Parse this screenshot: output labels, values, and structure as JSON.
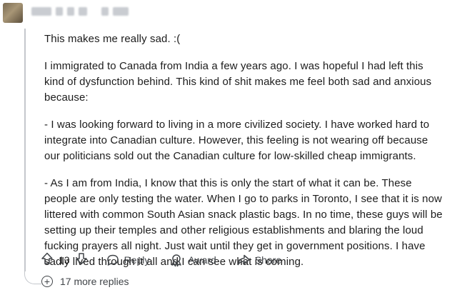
{
  "comment": {
    "paragraphs": [
      "This makes me really sad. :(",
      "I immigrated to Canada from India a few years ago. I was hopeful I had left this kind of dysfunction behind. This kind of shit makes me feel both sad and anxious because:",
      "- I was looking forward to living in a more civilized society. I have worked hard to integrate into Canadian culture. However, this feeling is not wearing off because our politicians sold out the Canadian culture for low-skilled cheap immigrants.",
      "- As I am from India, I know that this is only the start of what it can be. These people are only testing the water. When I go to parks in Toronto, I see that it is now littered with common South Asian snack plastic bags. In no time, these guys will be setting up their temples and other religious establishments and blaring the loud fucking prayers all night. Just wait until they get in government positions. I have sadly lived through it all and I can see what is coming."
    ]
  },
  "actions": {
    "vote_count": "13",
    "reply_label": "Reply",
    "award_label": "Award",
    "share_label": "Share"
  },
  "more_replies": {
    "label": "17 more replies",
    "icon": "plus-circle-icon"
  },
  "colors": {
    "thread_line": "#c4c7cc",
    "text": "#1c1c1c",
    "muted": "#404448"
  }
}
